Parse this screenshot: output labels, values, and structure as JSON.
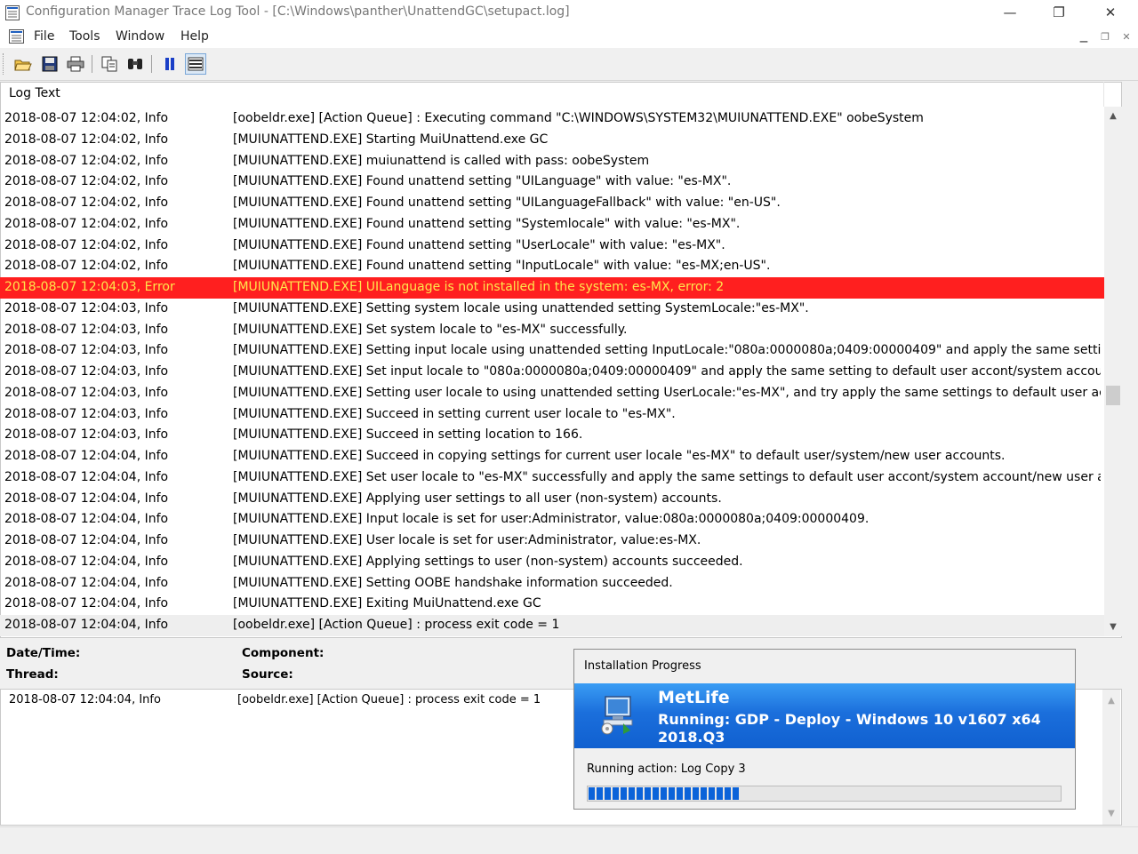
{
  "window": {
    "title": "Configuration Manager Trace Log Tool - [C:\\Windows\\panther\\UnattendGC\\setupact.log]",
    "minimize_glyph": "—",
    "maximize_glyph": "❐",
    "close_glyph": "✕"
  },
  "menu": {
    "items": [
      "File",
      "Tools",
      "Window",
      "Help"
    ]
  },
  "toolbar": {
    "buttons": [
      "open-icon",
      "save-icon",
      "print-icon",
      "copy-icon",
      "find-icon",
      "pause-icon",
      "highlight-icon"
    ]
  },
  "log": {
    "header": "Log Text",
    "rows": [
      {
        "dt": "2018-08-07 12:04:02, Info",
        "msg": "[oobeldr.exe] [Action Queue] : Executing command \"C:\\WINDOWS\\SYSTEM32\\MUIUNATTEND.EXE\"  oobeSystem"
      },
      {
        "dt": "2018-08-07 12:04:02, Info",
        "msg": "[MUIUNATTEND.EXE] Starting MuiUnattend.exe GC"
      },
      {
        "dt": "2018-08-07 12:04:02, Info",
        "msg": "[MUIUNATTEND.EXE] muiunattend is called with pass: oobeSystem"
      },
      {
        "dt": "2018-08-07 12:04:02, Info",
        "msg": "[MUIUNATTEND.EXE] Found unattend setting \"UILanguage\" with value: \"es-MX\"."
      },
      {
        "dt": "2018-08-07 12:04:02, Info",
        "msg": "[MUIUNATTEND.EXE] Found unattend setting \"UILanguageFallback\" with value: \"en-US\"."
      },
      {
        "dt": "2018-08-07 12:04:02, Info",
        "msg": "[MUIUNATTEND.EXE] Found unattend setting \"Systemlocale\" with value: \"es-MX\"."
      },
      {
        "dt": "2018-08-07 12:04:02, Info",
        "msg": "[MUIUNATTEND.EXE] Found unattend setting \"UserLocale\" with value: \"es-MX\"."
      },
      {
        "dt": "2018-08-07 12:04:02, Info",
        "msg": "[MUIUNATTEND.EXE] Found unattend setting \"InputLocale\" with value: \"es-MX;en-US\"."
      },
      {
        "dt": "2018-08-07 12:04:03, Error",
        "msg": "[MUIUNATTEND.EXE] UILanguage is not installed in the system: es-MX, error: 2"
      },
      {
        "dt": "2018-08-07 12:04:03, Info",
        "msg": "[MUIUNATTEND.EXE] Setting system locale using unattended setting SystemLocale:\"es-MX\"."
      },
      {
        "dt": "2018-08-07 12:04:03, Info",
        "msg": "[MUIUNATTEND.EXE] Set system locale to \"es-MX\" successfully."
      },
      {
        "dt": "2018-08-07 12:04:03, Info",
        "msg": "[MUIUNATTEND.EXE] Setting input locale using unattended setting InputLocale:\"080a:0000080a;0409:00000409\" and apply the same setting to defa..."
      },
      {
        "dt": "2018-08-07 12:04:03, Info",
        "msg": "[MUIUNATTEND.EXE] Set input locale to \"080a:0000080a;0409:00000409\" and apply the same setting to default user accont/system accounts/new u..."
      },
      {
        "dt": "2018-08-07 12:04:03, Info",
        "msg": "[MUIUNATTEND.EXE] Setting user locale to using unattended setting UserLocale:\"es-MX\", and try apply the same settings to default user accont/s..."
      },
      {
        "dt": "2018-08-07 12:04:03, Info",
        "msg": "[MUIUNATTEND.EXE] Succeed in setting current user locale to \"es-MX\"."
      },
      {
        "dt": "2018-08-07 12:04:03, Info",
        "msg": "[MUIUNATTEND.EXE] Succeed in setting location to 166."
      },
      {
        "dt": "2018-08-07 12:04:04, Info",
        "msg": "[MUIUNATTEND.EXE] Succeed in copying settings for current user locale \"es-MX\" to default user/system/new user accounts."
      },
      {
        "dt": "2018-08-07 12:04:04, Info",
        "msg": "[MUIUNATTEND.EXE] Set user locale to \"es-MX\" successfully and apply the same settings to default user accont/system account/new user account."
      },
      {
        "dt": "2018-08-07 12:04:04, Info",
        "msg": "[MUIUNATTEND.EXE] Applying user settings to all user (non-system) accounts."
      },
      {
        "dt": "2018-08-07 12:04:04, Info",
        "msg": "[MUIUNATTEND.EXE] Input locale is set for user:Administrator, value:080a:0000080a;0409:00000409."
      },
      {
        "dt": "2018-08-07 12:04:04, Info",
        "msg": "[MUIUNATTEND.EXE] User locale is set for user:Administrator, value:es-MX."
      },
      {
        "dt": "2018-08-07 12:04:04, Info",
        "msg": "[MUIUNATTEND.EXE] Applying settings to user (non-system) accounts succeeded."
      },
      {
        "dt": "2018-08-07 12:04:04, Info",
        "msg": "[MUIUNATTEND.EXE] Setting OOBE handshake information succeeded."
      },
      {
        "dt": "2018-08-07 12:04:04, Info",
        "msg": "[MUIUNATTEND.EXE] Exiting MuiUnattend.exe GC"
      },
      {
        "dt": "2018-08-07 12:04:04, Info",
        "msg": "[oobeldr.exe] [Action Queue] : process exit code = 1"
      }
    ],
    "error_row_index": 8,
    "selected_row_index": 24
  },
  "details": {
    "date_label": "Date/Time:",
    "component_label": "Component:",
    "thread_label": "Thread:",
    "source_label": "Source:",
    "selected_dt": "2018-08-07 12:04:04, Info",
    "selected_msg": "[oobeldr.exe] [Action Queue] : process exit code = 1"
  },
  "progress_dialog": {
    "title": "Installation Progress",
    "company": "MetLife",
    "running": "Running: GDP - Deploy - Windows 10 v1607 x64 2018.Q3",
    "action": "Running action: Log Copy 3",
    "progress_fraction": 0.32
  },
  "colors": {
    "error_row_bg": "#ff1f1f",
    "error_row_text": "#ffe64c",
    "banner_blue": "#1b6fdc",
    "progress_blue": "#0b63d9"
  }
}
